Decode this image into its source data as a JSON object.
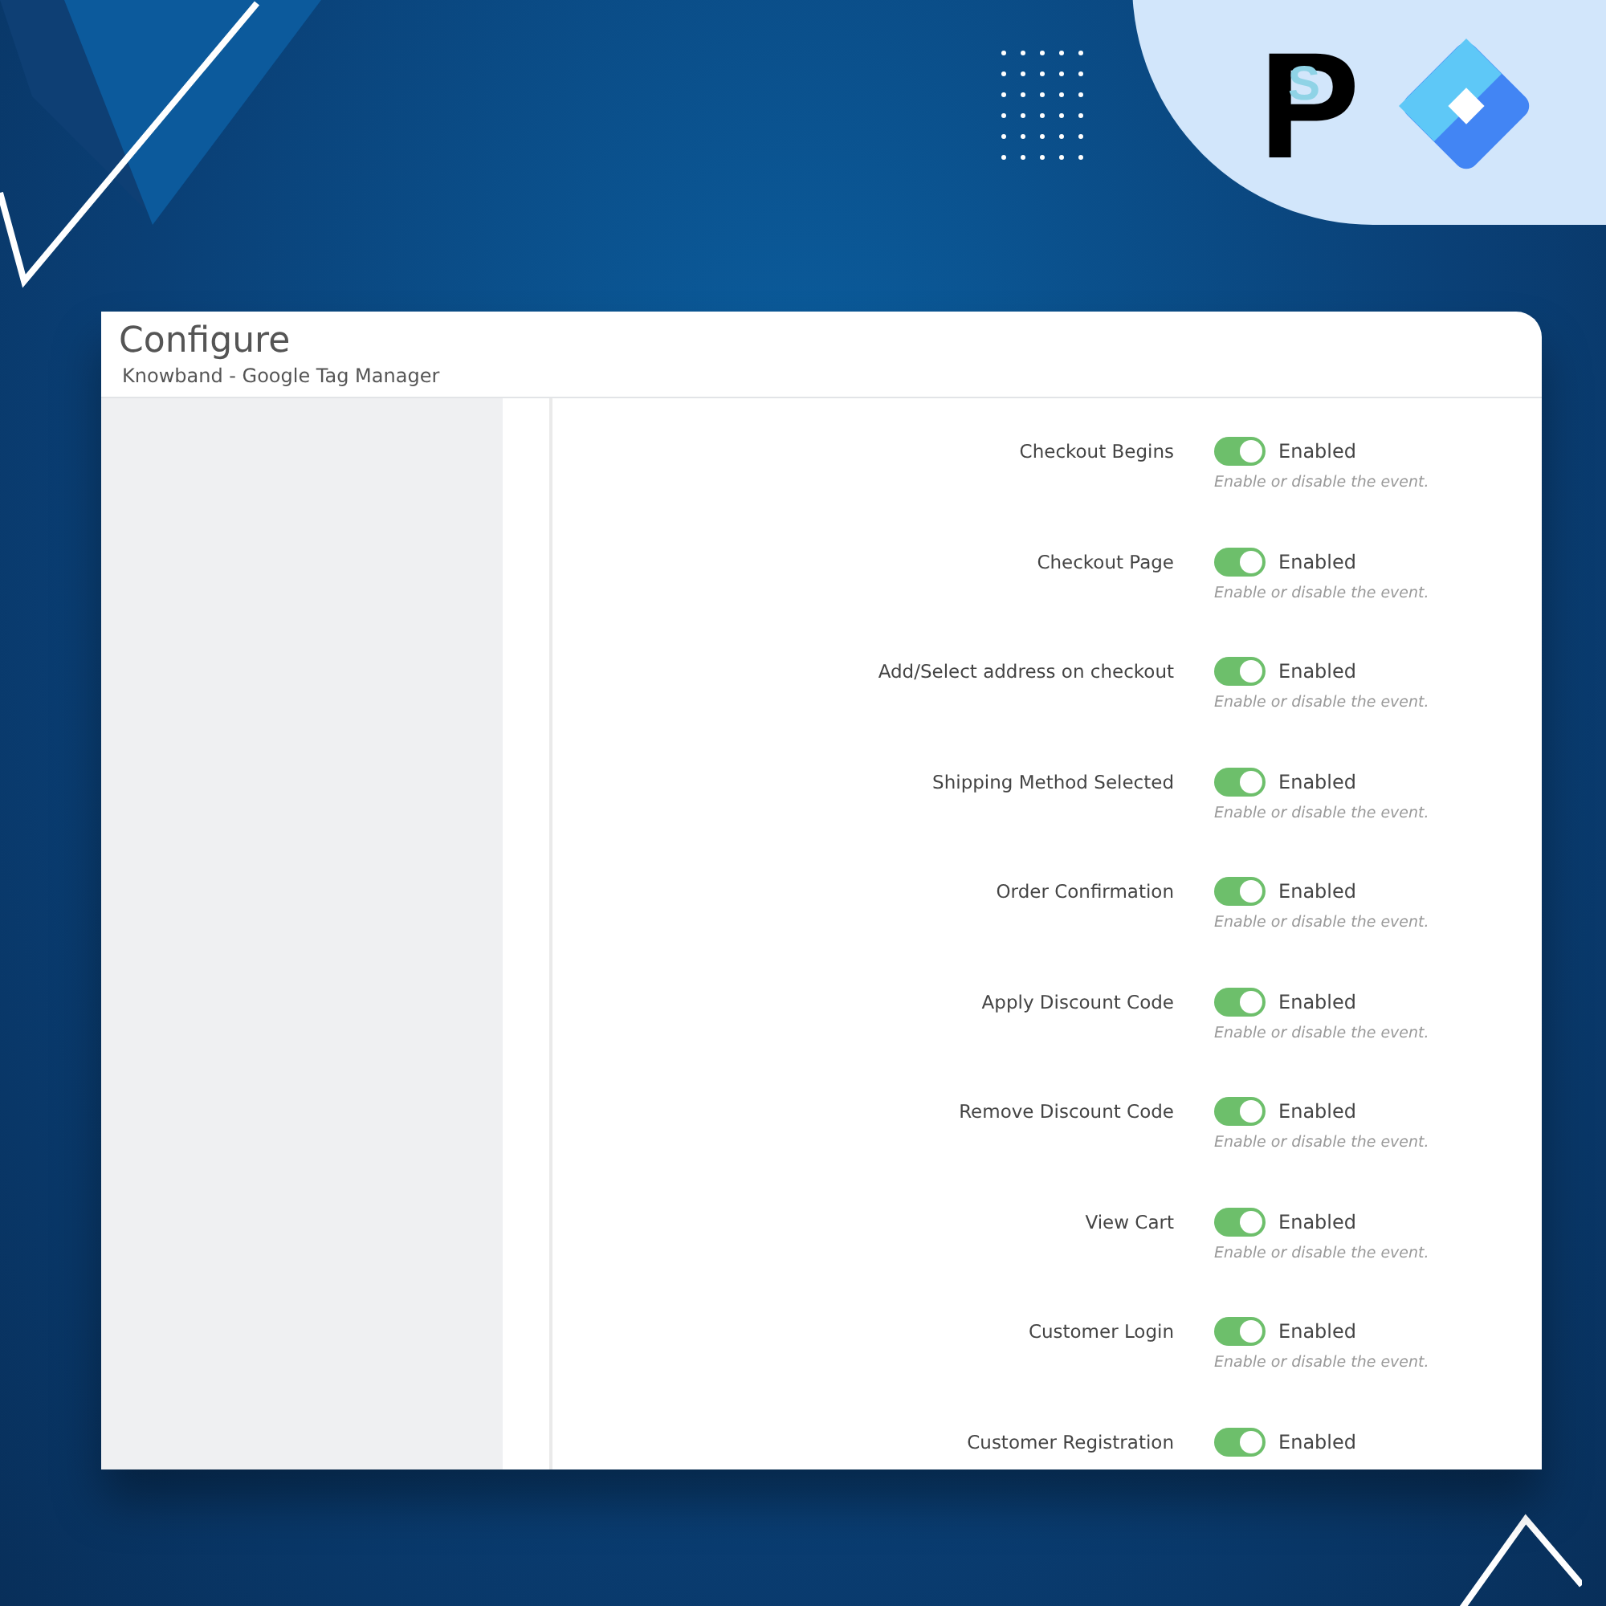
{
  "brand_logo": {
    "letter": "P",
    "inner_letter": "S"
  },
  "window": {
    "title": "Configure",
    "subtitle": "Knowband - Google Tag Manager"
  },
  "events": [
    {
      "label": "Checkout Begins",
      "on": true,
      "state_text": "Enabled",
      "help": "Enable or disable the event."
    },
    {
      "label": "Checkout Page",
      "on": true,
      "state_text": "Enabled",
      "help": "Enable or disable the event."
    },
    {
      "label": "Add/Select address on checkout",
      "on": true,
      "state_text": "Enabled",
      "help": "Enable or disable the event."
    },
    {
      "label": "Shipping Method Selected",
      "on": true,
      "state_text": "Enabled",
      "help": "Enable or disable the event."
    },
    {
      "label": "Order Confirmation",
      "on": true,
      "state_text": "Enabled",
      "help": "Enable or disable the event."
    },
    {
      "label": "Apply Discount Code",
      "on": true,
      "state_text": "Enabled",
      "help": "Enable or disable the event."
    },
    {
      "label": "Remove Discount Code",
      "on": true,
      "state_text": "Enabled",
      "help": "Enable or disable the event."
    },
    {
      "label": "View Cart",
      "on": true,
      "state_text": "Enabled",
      "help": "Enable or disable the event."
    },
    {
      "label": "Customer Login",
      "on": true,
      "state_text": "Enabled",
      "help": "Enable or disable the event."
    },
    {
      "label": "Customer Registration",
      "on": true,
      "state_text": "Enabled"
    }
  ]
}
